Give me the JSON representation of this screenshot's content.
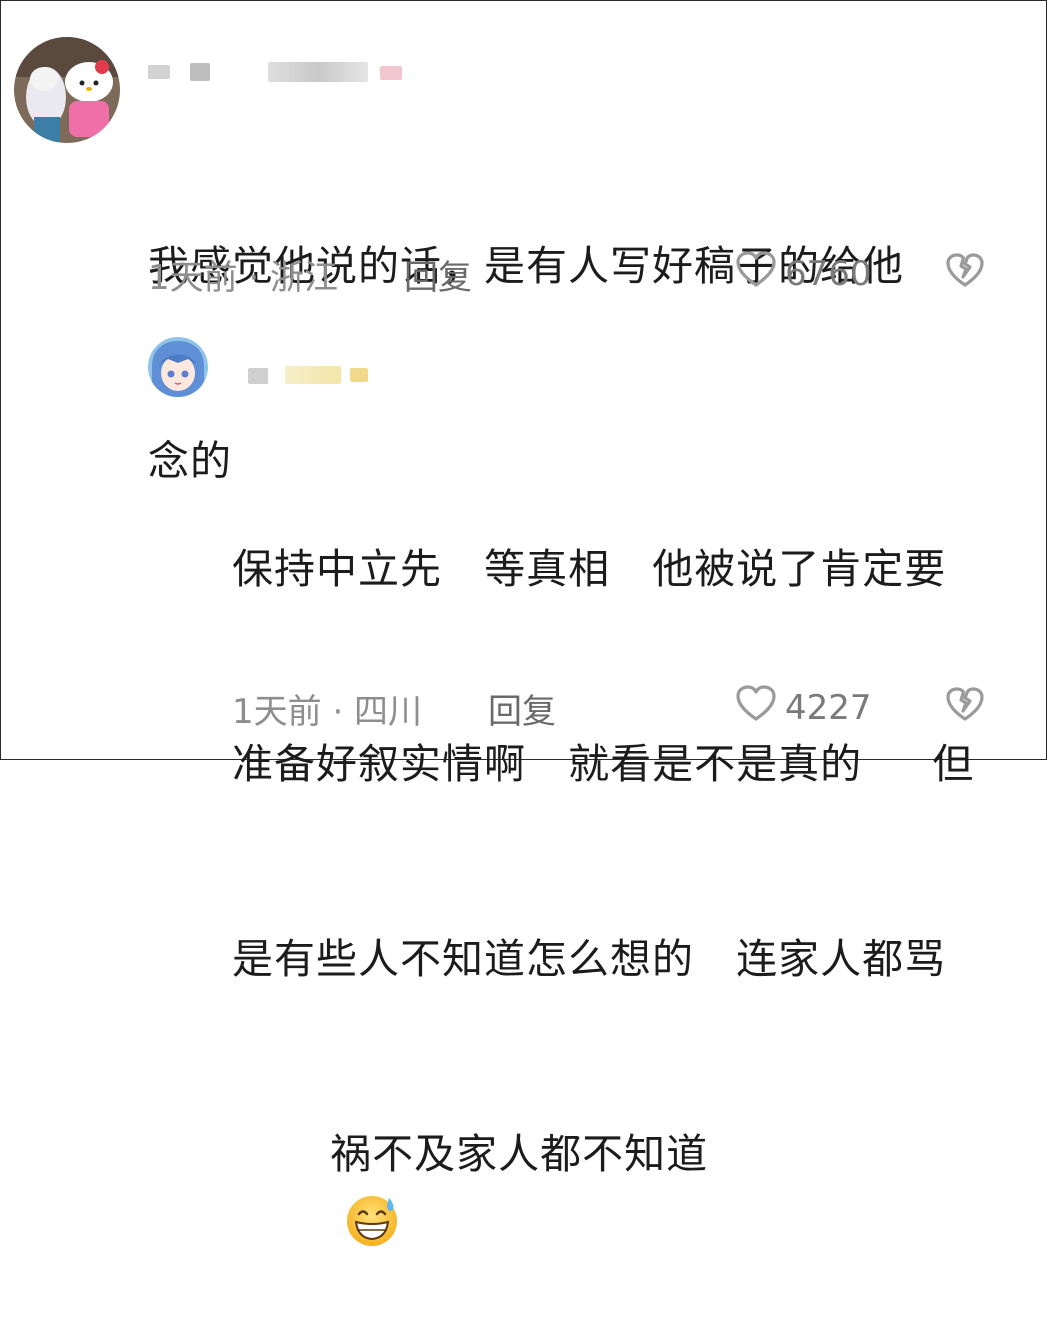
{
  "comments": [
    {
      "text_lines": [
        "我感觉他说的话，是有人写好稿子的给他",
        "念的"
      ],
      "meta": "1天前 · 浙江",
      "reply_label": "回复",
      "like_count": "6760"
    },
    {
      "text_lines": [
        "保持中立先   等真相   他被说了肯定要",
        "准备好叙实情啊   就看是不是真的     但",
        "是有些人不知道怎么想的   连家人都骂",
        "   祸不及家人都不知道"
      ],
      "emoji": "grinning-sweat",
      "meta": "1天前 · 四川",
      "reply_label": "回复",
      "like_count": "4227"
    }
  ],
  "colors": {
    "text": "#1c1c1c",
    "meta": "#8e8e8e",
    "icon": "#9a9a9a"
  },
  "icons": {
    "like": "heart-outline-icon",
    "dislike": "broken-heart-icon"
  }
}
